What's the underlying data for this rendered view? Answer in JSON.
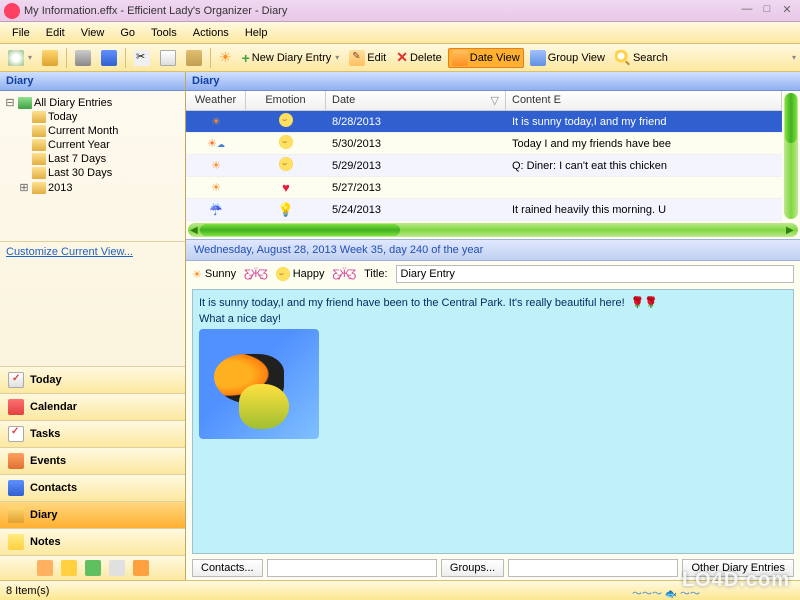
{
  "window": {
    "title": "My Information.effx - Efficient Lady's Organizer - Diary"
  },
  "menu": {
    "items": [
      "File",
      "Edit",
      "View",
      "Go",
      "Tools",
      "Actions",
      "Help"
    ]
  },
  "toolbar": {
    "new_entry": "New Diary Entry",
    "edit": "Edit",
    "delete": "Delete",
    "date_view": "Date View",
    "group_view": "Group View",
    "search": "Search"
  },
  "sidebar": {
    "header": "Diary",
    "tree": {
      "root": "All Diary Entries",
      "nodes": [
        "Today",
        "Current Month",
        "Current Year",
        "Last 7 Days",
        "Last 30 Days",
        "2013"
      ]
    },
    "customize": "Customize Current View...",
    "nav": [
      {
        "key": "today",
        "label": "Today"
      },
      {
        "key": "calendar",
        "label": "Calendar"
      },
      {
        "key": "tasks",
        "label": "Tasks"
      },
      {
        "key": "events",
        "label": "Events"
      },
      {
        "key": "contacts",
        "label": "Contacts"
      },
      {
        "key": "diary",
        "label": "Diary"
      },
      {
        "key": "notes",
        "label": "Notes"
      }
    ]
  },
  "grid": {
    "header": "Diary",
    "columns": {
      "weather": "Weather",
      "emotion": "Emotion",
      "date": "Date",
      "content": "Content E"
    },
    "rows": [
      {
        "weather": "☀",
        "emotion": "smile",
        "date": "8/28/2013",
        "content": "It is sunny today,I and my friend",
        "selected": true
      },
      {
        "weather": "⛅",
        "emotion": "smile",
        "date": "5/30/2013",
        "content": "Today I and my friends have bee"
      },
      {
        "weather": "☀",
        "emotion": "smile",
        "date": "5/29/2013",
        "content": "Q: Diner: I can't eat this chicken"
      },
      {
        "weather": "☀",
        "emotion": "heart",
        "date": "5/27/2013",
        "content": ""
      },
      {
        "weather": "🌧",
        "emotion": "bulb",
        "date": "5/24/2013",
        "content": "It rained heavily this morning. U"
      }
    ]
  },
  "detail": {
    "datebar": "Wednesday, August 28, 2013  Week 35, day 240 of the year",
    "weather_label": "Sunny",
    "emotion_label": "Happy",
    "title_label": "Title:",
    "title_value": "Diary Entry",
    "body_line1": "It is sunny today,I and my friend have been to the Central Park. It's really beautiful here!",
    "body_line2": "What a nice day!"
  },
  "bottom": {
    "contacts_btn": "Contacts...",
    "groups_btn": "Groups...",
    "other_btn": "Other Diary Entries"
  },
  "status": {
    "items": "8 Item(s)"
  },
  "watermark": "LO4D.com"
}
